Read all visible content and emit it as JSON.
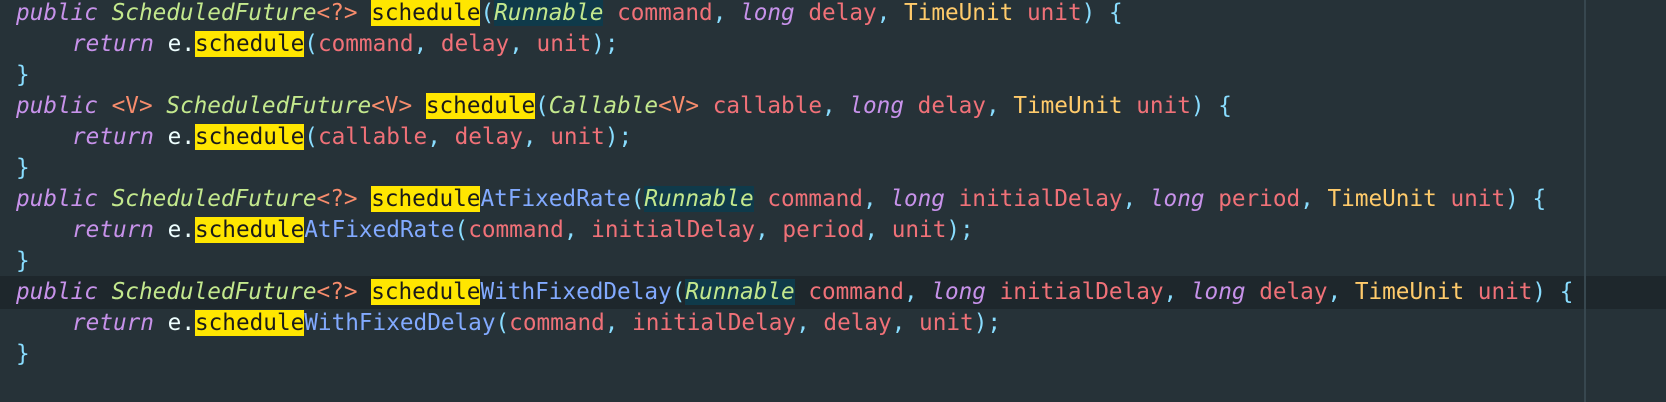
{
  "code": {
    "l1": {
      "public": "public",
      "sf": "ScheduledFuture",
      "wild": "<?>",
      "schedule": "schedule",
      "open": "(",
      "runnable": "Runnable",
      "command": "command",
      "comma1": ",",
      "long": "long",
      "delay": "delay",
      "comma2": ",",
      "timeunit": "TimeUnit",
      "unit": "unit",
      "close": ")",
      "brace": "{"
    },
    "l2": {
      "ret": "return",
      "e": "e",
      "dot": ".",
      "schedule": "schedule",
      "open": "(",
      "command": "command",
      "comma1": ",",
      "delay": "delay",
      "comma2": ",",
      "unit": "unit",
      "close": ")",
      "semi": ";"
    },
    "l3": {
      "brace": "}"
    },
    "l4": {
      "public": "public",
      "v": "<V>",
      "sf": "ScheduledFuture",
      "v2": "<V>",
      "schedule": "schedule",
      "open": "(",
      "callable": "Callable",
      "v3": "<V>",
      "callable_arg": "callable",
      "comma1": ",",
      "long": "long",
      "delay": "delay",
      "comma2": ",",
      "timeunit": "TimeUnit",
      "unit": "unit",
      "close": ")",
      "brace": "{"
    },
    "l5": {
      "ret": "return",
      "e": "e",
      "dot": ".",
      "schedule": "schedule",
      "open": "(",
      "callable": "callable",
      "comma1": ",",
      "delay": "delay",
      "comma2": ",",
      "unit": "unit",
      "close": ")",
      "semi": ";"
    },
    "l6": {
      "brace": "}"
    },
    "l7": {
      "public": "public",
      "sf": "ScheduledFuture",
      "wild": "<?>",
      "schedule": "schedule",
      "rest": "AtFixedRate",
      "open": "(",
      "runnable": "Runnable",
      "command": "command",
      "comma1": ",",
      "long1": "long",
      "initialDelay": "initialDelay",
      "comma2": ",",
      "long2": "long",
      "period": "period",
      "comma3": ",",
      "timeunit": "TimeUnit",
      "unit": "unit",
      "close": ")",
      "brace": "{"
    },
    "l8": {
      "ret": "return",
      "e": "e",
      "dot": ".",
      "schedule": "schedule",
      "rest": "AtFixedRate",
      "open": "(",
      "command": "command",
      "comma1": ",",
      "initialDelay": "initialDelay",
      "comma2": ",",
      "period": "period",
      "comma3": ",",
      "unit": "unit",
      "close": ")",
      "semi": ";"
    },
    "l9": {
      "brace": "}"
    },
    "l10": {
      "public": "public",
      "sf": "ScheduledFuture",
      "wild": "<?>",
      "schedule": "schedule",
      "rest": "WithFixedDelay",
      "open": "(",
      "runnable": "Runnable",
      "command": "command",
      "comma1": ",",
      "long1": "long",
      "initialDelay": "initialDelay",
      "comma2": ",",
      "long2": "long",
      "delay": "delay",
      "comma3": ",",
      "timeunit": "TimeUnit",
      "unit": "unit",
      "close": ")",
      "brace": "{"
    },
    "l11": {
      "ret": "return",
      "e": "e",
      "dot": ".",
      "schedule": "schedule",
      "rest": "WithFixedDelay",
      "open": "(",
      "command": "command",
      "comma1": ",",
      "initialDelay": "initialDelay",
      "comma2": ",",
      "delay": "delay",
      "comma3": ",",
      "unit": "unit",
      "close": ")",
      "semi": ";"
    },
    "l12": {
      "brace": "}"
    }
  }
}
